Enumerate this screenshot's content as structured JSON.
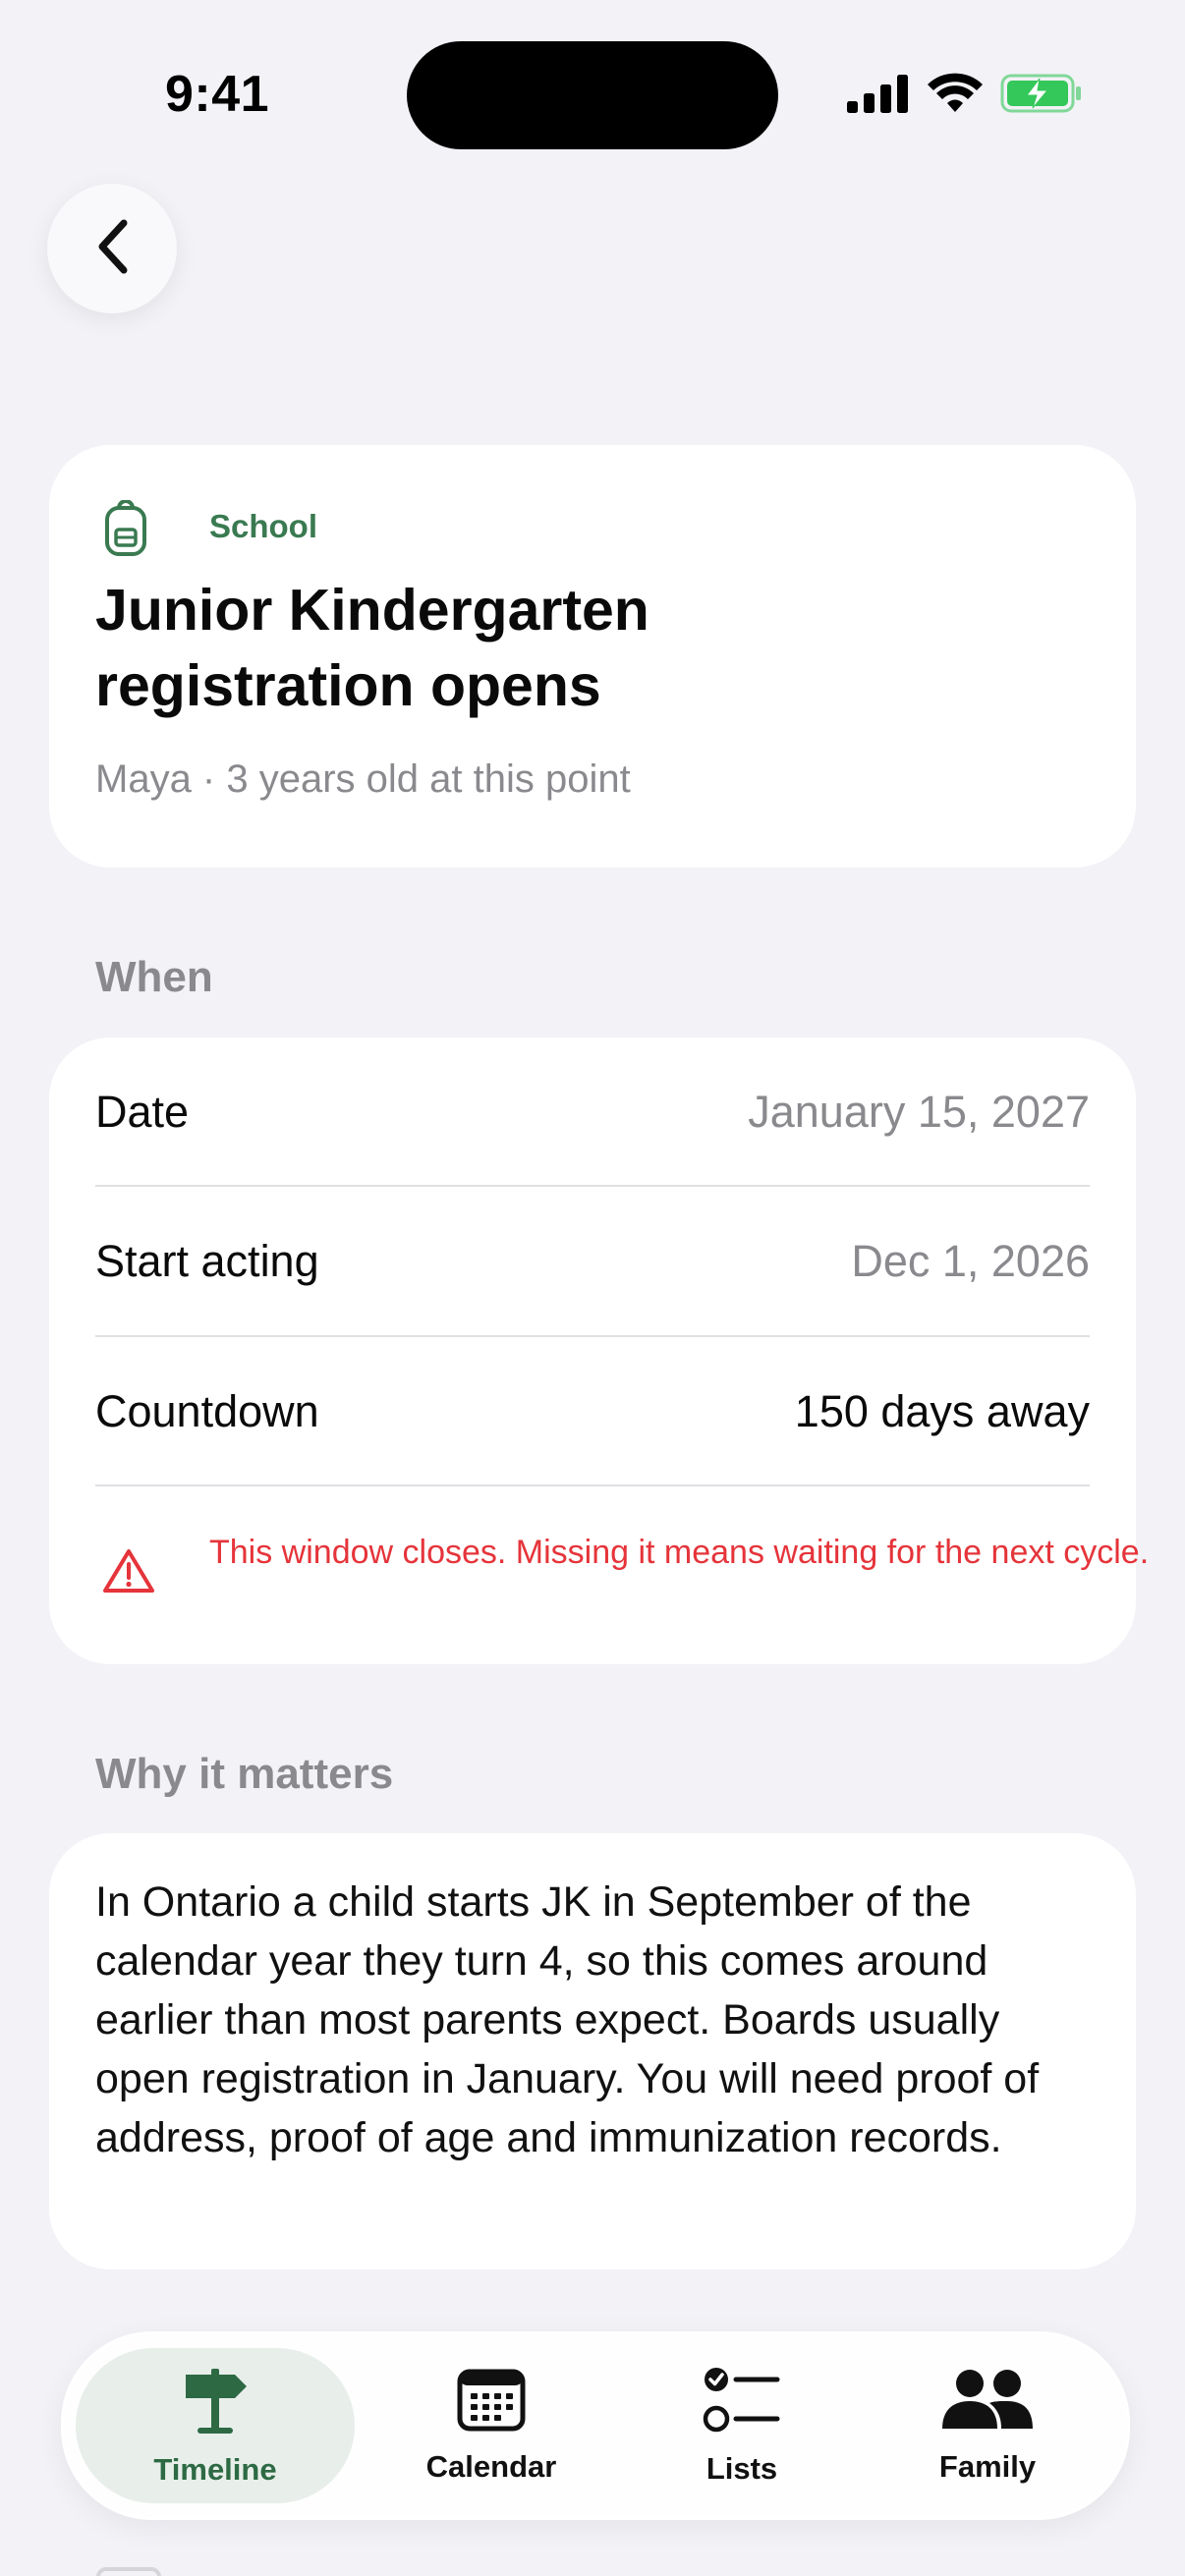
{
  "status_bar": {
    "time": "9:41"
  },
  "event": {
    "category": "School",
    "title": "Junior Kindergarten registration opens",
    "subtitle": "Maya · 3 years old at this point"
  },
  "when": {
    "section_label": "When",
    "rows": [
      {
        "label": "Date",
        "value": "January 15, 2027"
      },
      {
        "label": "Start acting",
        "value": "Dec 1, 2026"
      },
      {
        "label": "Countdown",
        "value": "150 days away"
      }
    ],
    "warning": "This window closes. Missing it means waiting for the next cycle."
  },
  "why": {
    "section_label": "Why it matters",
    "text": "In Ontario a child starts JK in September of the calendar year they turn 4, so this comes around earlier than most parents expect. Boards usually open registration in January. You will need proof of address, proof of age and immunization records."
  },
  "tab_bar": {
    "tabs": [
      {
        "label": "Timeline",
        "icon": "signpost-icon",
        "active": true
      },
      {
        "label": "Calendar",
        "icon": "calendar-icon",
        "active": false
      },
      {
        "label": "Lists",
        "icon": "checklist-icon",
        "active": false
      },
      {
        "label": "Family",
        "icon": "people-icon",
        "active": false
      }
    ]
  },
  "colors": {
    "accent_green": "#3a7a51",
    "warning_red": "#e5343a",
    "background": "#f2f2f7"
  }
}
